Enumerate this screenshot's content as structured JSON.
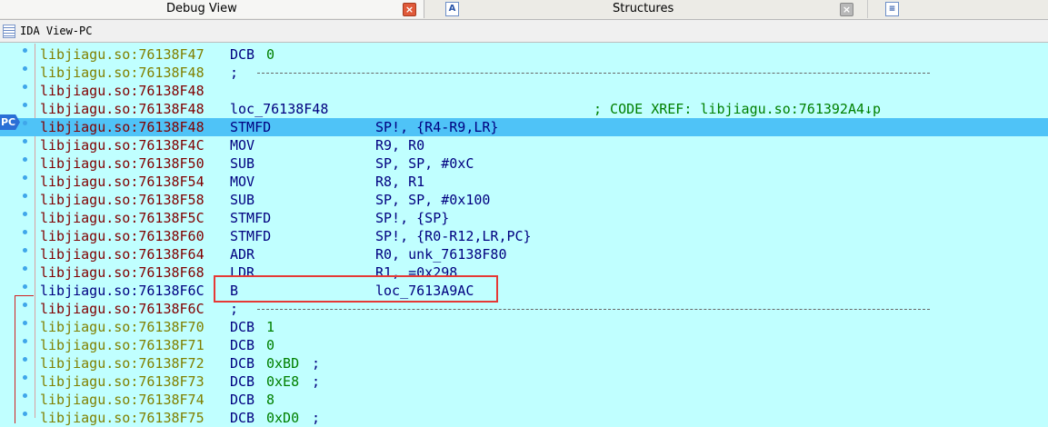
{
  "tabs": [
    {
      "label": "Debug View",
      "close": "×"
    },
    {
      "label": "Structures",
      "close": "×",
      "icon": "A"
    },
    {
      "icon": "≡"
    }
  ],
  "view": {
    "title": "IDA View-PC"
  },
  "pc_label": "PC",
  "rows": [
    {
      "addr": "libjiagu.so:76138F47",
      "mnem": "DCB",
      "value": "0",
      "kind": "dcb"
    },
    {
      "addr": "libjiagu.so:76138F48",
      "kind": "sep",
      "semicolon": ";"
    },
    {
      "addr": "libjiagu.so:76138F48",
      "kind": "empty"
    },
    {
      "addr": "libjiagu.so:76138F48",
      "mnem": "loc_76138F48",
      "xref": "; CODE XREF: libjiagu.so:761392A4↓p",
      "kind": "label"
    },
    {
      "addr": "libjiagu.so:76138F48",
      "mnem": "STMFD",
      "oper": "SP!, {R4-R9,LR}",
      "kind": "insn",
      "current": true
    },
    {
      "addr": "libjiagu.so:76138F4C",
      "mnem": "MOV",
      "oper": "R9, R0",
      "kind": "insn"
    },
    {
      "addr": "libjiagu.so:76138F50",
      "mnem": "SUB",
      "oper": "SP, SP, #0xC",
      "kind": "insn"
    },
    {
      "addr": "libjiagu.so:76138F54",
      "mnem": "MOV",
      "oper": "R8, R1",
      "kind": "insn"
    },
    {
      "addr": "libjiagu.so:76138F58",
      "mnem": "SUB",
      "oper": "SP, SP, #0x100",
      "kind": "insn"
    },
    {
      "addr": "libjiagu.so:76138F5C",
      "mnem": "STMFD",
      "oper": "SP!, {SP}",
      "kind": "insn"
    },
    {
      "addr": "libjiagu.so:76138F60",
      "mnem": "STMFD",
      "oper": "SP!, {R0-R12,LR,PC}",
      "kind": "insn"
    },
    {
      "addr": "libjiagu.so:76138F64",
      "mnem": "ADR",
      "oper": "R0, unk_76138F80",
      "kind": "insn"
    },
    {
      "addr": "libjiagu.so:76138F68",
      "mnem": "LDR",
      "oper": "R1, =0x298",
      "kind": "insn"
    },
    {
      "addr": "libjiagu.so:76138F6C",
      "mnem": "B",
      "oper": "loc_7613A9AC",
      "kind": "insn",
      "branch": true
    },
    {
      "addr": "libjiagu.so:76138F6C",
      "kind": "sep",
      "semicolon": ";"
    },
    {
      "addr": "libjiagu.so:76138F70",
      "mnem": "DCB",
      "value": "1",
      "kind": "dcb"
    },
    {
      "addr": "libjiagu.so:76138F71",
      "mnem": "DCB",
      "value": "0",
      "kind": "dcb"
    },
    {
      "addr": "libjiagu.so:76138F72",
      "mnem": "DCB",
      "value": "0xBD",
      "comment": ";",
      "kind": "dcb"
    },
    {
      "addr": "libjiagu.so:76138F73",
      "mnem": "DCB",
      "value": "0xE8",
      "comment": ";",
      "kind": "dcb"
    },
    {
      "addr": "libjiagu.so:76138F74",
      "mnem": "DCB",
      "value": "8",
      "kind": "dcb"
    },
    {
      "addr": "libjiagu.so:76138F75",
      "mnem": "DCB",
      "value": "0xD0",
      "comment": ";",
      "kind": "dcb"
    }
  ]
}
